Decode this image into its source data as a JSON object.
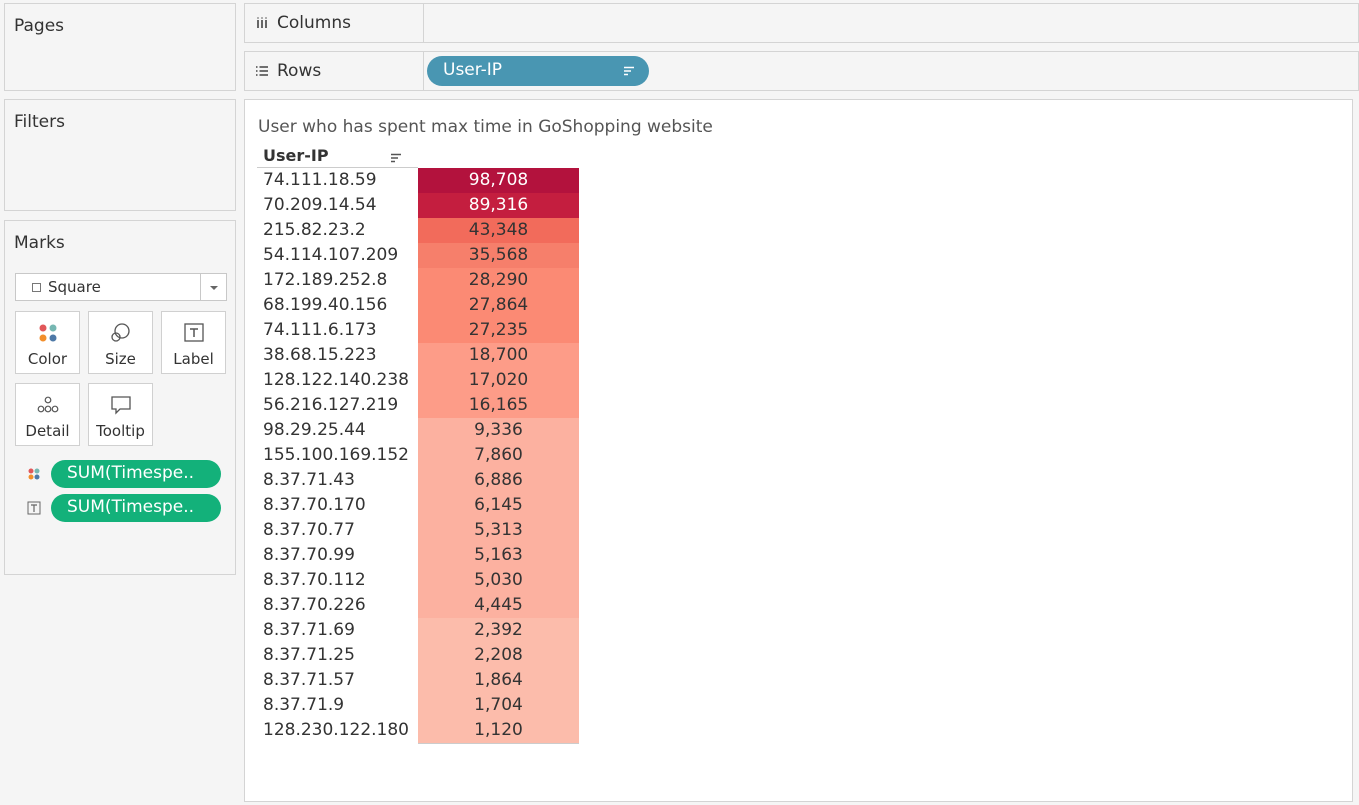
{
  "cards": {
    "pages_title": "Pages",
    "filters_title": "Filters",
    "marks_title": "Marks"
  },
  "marks": {
    "mark_type": "Square",
    "buttons": {
      "color": "Color",
      "size": "Size",
      "label": "Label",
      "detail": "Detail",
      "tooltip": "Tooltip"
    },
    "pills": [
      {
        "icon": "color-dots-icon",
        "label": "SUM(Timespe.."
      },
      {
        "icon": "text-label-icon",
        "label": "SUM(Timespe.."
      }
    ]
  },
  "shelves": {
    "columns_label": "Columns",
    "rows_label": "Rows",
    "rows_pill": "User-IP"
  },
  "sheet": {
    "title": "User who has spent max time in GoShopping website",
    "row_header": "User-IP"
  },
  "colors": {
    "dimension_pill": "#4996b2",
    "measure_pill": "#13b17a",
    "heat_max": "#b3123d",
    "heat_min": "#fcc0b1"
  },
  "chart_data": {
    "type": "table",
    "rows": [
      {
        "label": "74.111.18.59",
        "value": "98,708",
        "n": 98708,
        "color": "#b3123d",
        "fg": "#ffffff"
      },
      {
        "label": "70.209.14.54",
        "value": "89,316",
        "n": 89316,
        "color": "#c41e3f",
        "fg": "#ffffff"
      },
      {
        "label": "215.82.23.2",
        "value": "43,348",
        "n": 43348,
        "color": "#f26b5b",
        "fg": "#333333"
      },
      {
        "label": "54.114.107.209",
        "value": "35,568",
        "n": 35568,
        "color": "#f67f6b",
        "fg": "#333333"
      },
      {
        "label": "172.189.252.8",
        "value": "28,290",
        "n": 28290,
        "color": "#fb8a74",
        "fg": "#333333"
      },
      {
        "label": "68.199.40.156",
        "value": "27,864",
        "n": 27864,
        "color": "#fb8a74",
        "fg": "#333333"
      },
      {
        "label": "74.111.6.173",
        "value": "27,235",
        "n": 27235,
        "color": "#fb8a74",
        "fg": "#333333"
      },
      {
        "label": "38.68.15.223",
        "value": "18,700",
        "n": 18700,
        "color": "#fd9c88",
        "fg": "#333333"
      },
      {
        "label": "128.122.140.238",
        "value": "17,020",
        "n": 17020,
        "color": "#fd9c88",
        "fg": "#333333"
      },
      {
        "label": "56.216.127.219",
        "value": "16,165",
        "n": 16165,
        "color": "#fd9c88",
        "fg": "#333333"
      },
      {
        "label": "98.29.25.44",
        "value": "9,336",
        "n": 9336,
        "color": "#fcb1a0",
        "fg": "#333333"
      },
      {
        "label": "155.100.169.152",
        "value": "7,860",
        "n": 7860,
        "color": "#fcb1a0",
        "fg": "#333333"
      },
      {
        "label": "8.37.71.43",
        "value": "6,886",
        "n": 6886,
        "color": "#fcb1a0",
        "fg": "#333333"
      },
      {
        "label": "8.37.70.170",
        "value": "6,145",
        "n": 6145,
        "color": "#fcb1a0",
        "fg": "#333333"
      },
      {
        "label": "8.37.70.77",
        "value": "5,313",
        "n": 5313,
        "color": "#fcb1a0",
        "fg": "#333333"
      },
      {
        "label": "8.37.70.99",
        "value": "5,163",
        "n": 5163,
        "color": "#fcb1a0",
        "fg": "#333333"
      },
      {
        "label": "8.37.70.112",
        "value": "5,030",
        "n": 5030,
        "color": "#fcb1a0",
        "fg": "#333333"
      },
      {
        "label": "8.37.70.226",
        "value": "4,445",
        "n": 4445,
        "color": "#fcb1a0",
        "fg": "#333333"
      },
      {
        "label": "8.37.71.69",
        "value": "2,392",
        "n": 2392,
        "color": "#fcbcab",
        "fg": "#333333"
      },
      {
        "label": "8.37.71.25",
        "value": "2,208",
        "n": 2208,
        "color": "#fcbcab",
        "fg": "#333333"
      },
      {
        "label": "8.37.71.57",
        "value": "1,864",
        "n": 1864,
        "color": "#fcbcab",
        "fg": "#333333"
      },
      {
        "label": "8.37.71.9",
        "value": "1,704",
        "n": 1704,
        "color": "#fcbcab",
        "fg": "#333333"
      },
      {
        "label": "128.230.122.180",
        "value": "1,120",
        "n": 1120,
        "color": "#fcbcab",
        "fg": "#333333"
      }
    ]
  }
}
